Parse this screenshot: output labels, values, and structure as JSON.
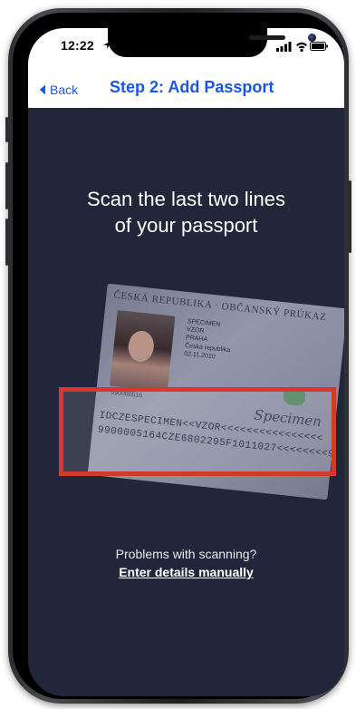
{
  "status_bar": {
    "time": "12:22",
    "icons": [
      "location-arrow-icon",
      "signal-icon",
      "wifi-icon",
      "battery-icon"
    ]
  },
  "nav": {
    "back_label": "Back",
    "title": "Step 2: Add Passport"
  },
  "main": {
    "instruction": "Scan the last two lines\nof your passport",
    "passport_sample": {
      "header": "ČESKÁ REPUBLIKA · OBČANSKÝ PRŮKAZ",
      "fields": [
        "SPECIMEN",
        "VZOR",
        "",
        "PRAHA",
        "Česká republika",
        "02.11.2010"
      ],
      "number": "990000516",
      "signature": "Specimen",
      "mrz_lines": [
        "IDCZESPECIMEN<<VZOR<<<<<<<<<<<<<<<<",
        "9900005164CZE6802295F1011027<<<<<<<<9"
      ]
    },
    "help_text": "Problems with scanning?",
    "help_link": "Enter details manually"
  },
  "colors": {
    "accent": "#1a56e8",
    "background": "#22263a",
    "scan_frame": "#d6392c"
  }
}
